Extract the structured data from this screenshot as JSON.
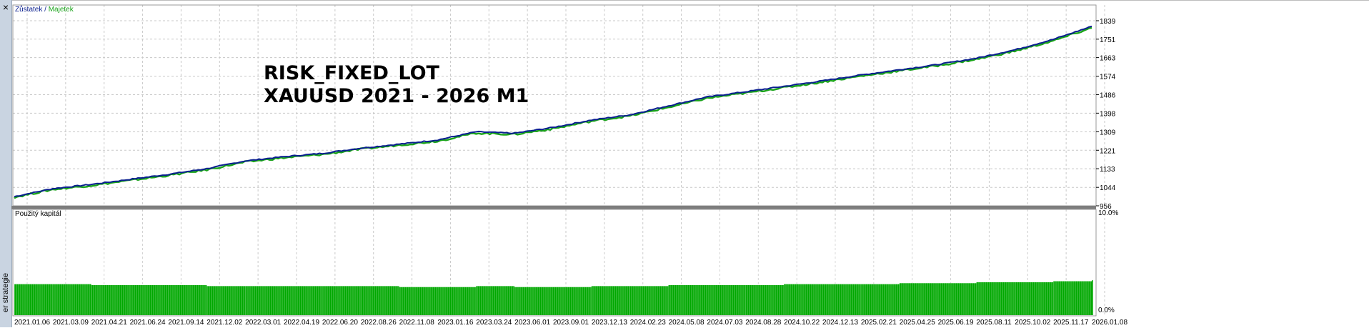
{
  "side_panel": {
    "close_glyph": "×",
    "label": "er strategie"
  },
  "colors": {
    "balance": "#0a1f8f",
    "equity": "#1aa31a",
    "usage_bars": "#00a800",
    "grid": "#c8c8c8"
  },
  "overlay": {
    "line1": "RISK_FIXED_LOT",
    "line2": "XAUUSD 2021 - 2026 M1"
  },
  "chart_data": [
    {
      "type": "line",
      "legend": {
        "balance": "Zůstatek",
        "separator": " / ",
        "equity": "Majetek",
        "placement": "top-left"
      },
      "y_ticks": [
        "1839",
        "1751",
        "1663",
        "1574",
        "1486",
        "1398",
        "1309",
        "1221",
        "1133",
        "1044",
        "956"
      ],
      "ylim": [
        956,
        1839
      ],
      "grid": true,
      "x": [
        "2021.01.06",
        "2021.03.09",
        "2021.04.21",
        "2021.06.24",
        "2021.09.14",
        "2021.12.02",
        "2022.03.01",
        "2022.04.19",
        "2022.06.20",
        "2022.08.26",
        "2022.11.08",
        "2023.01.16",
        "2023.03.24",
        "2023.06.01",
        "2023.09.01",
        "2023.12.13",
        "2024.02.23",
        "2024.05.08",
        "2024.07.03",
        "2024.08.28",
        "2024.10.22",
        "2024.12.13",
        "2025.02.21",
        "2025.04.25",
        "2025.06.19",
        "2025.08.11",
        "2025.10.02",
        "2025.11.17",
        "2026.01.08"
      ],
      "series": [
        {
          "name": "Zůstatek",
          "values": [
            1000,
            1038,
            1058,
            1082,
            1106,
            1133,
            1170,
            1190,
            1206,
            1231,
            1250,
            1270,
            1309,
            1302,
            1330,
            1365,
            1390,
            1433,
            1475,
            1500,
            1526,
            1552,
            1580,
            1605,
            1630,
            1660,
            1700,
            1750,
            1812
          ]
        },
        {
          "name": "Majetek",
          "values": [
            997,
            1034,
            1053,
            1077,
            1101,
            1128,
            1165,
            1185,
            1201,
            1226,
            1246,
            1265,
            1303,
            1297,
            1324,
            1360,
            1385,
            1426,
            1469,
            1494,
            1520,
            1547,
            1575,
            1600,
            1625,
            1655,
            1694,
            1743,
            1805
          ]
        }
      ]
    },
    {
      "type": "bar",
      "label": "Použitý kapitál",
      "y_ticks": [
        "10.0%",
        "0.0%"
      ],
      "ylim": [
        0,
        10
      ],
      "x": [
        "2021.01.06",
        "2021.03.09",
        "2021.04.21",
        "2021.06.24",
        "2021.09.14",
        "2021.12.02",
        "2022.03.01",
        "2022.04.19",
        "2022.06.20",
        "2022.08.26",
        "2022.11.08",
        "2023.01.16",
        "2023.03.24",
        "2023.06.01",
        "2023.09.01",
        "2023.12.13",
        "2024.02.23",
        "2024.05.08",
        "2024.07.03",
        "2024.08.28",
        "2024.10.22",
        "2024.12.13",
        "2025.02.21",
        "2025.04.25",
        "2025.06.19",
        "2025.08.11",
        "2025.10.02",
        "2025.11.17",
        "2026.01.08"
      ],
      "values": [
        2.6,
        2.6,
        2.5,
        2.5,
        2.5,
        2.4,
        2.4,
        2.4,
        2.4,
        2.4,
        2.3,
        2.3,
        2.4,
        2.3,
        2.3,
        2.4,
        2.4,
        2.5,
        2.5,
        2.5,
        2.6,
        2.6,
        2.6,
        2.7,
        2.7,
        2.8,
        2.8,
        2.9,
        3.0
      ]
    }
  ]
}
